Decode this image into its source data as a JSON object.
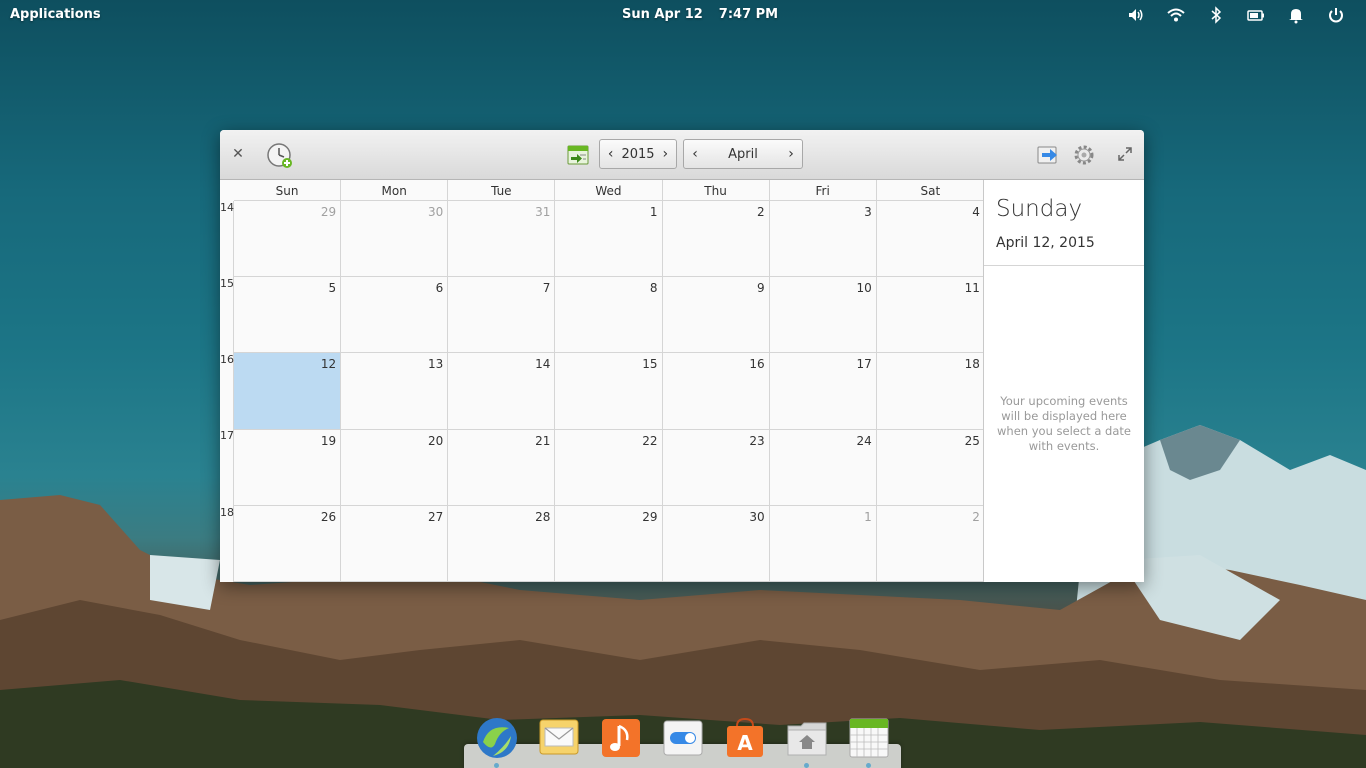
{
  "panel": {
    "applications": "Applications",
    "date": "Sun Apr 12",
    "time": "7:47 PM",
    "indicators": [
      "volume-icon",
      "wifi-icon",
      "bluetooth-icon",
      "battery-icon",
      "notifications-icon",
      "power-icon"
    ]
  },
  "window": {
    "year": "2015",
    "month": "April",
    "weekdays": [
      "Sun",
      "Mon",
      "Tue",
      "Wed",
      "Thu",
      "Fri",
      "Sat"
    ],
    "week_numbers": [
      "14",
      "15",
      "16",
      "17",
      "18"
    ],
    "weeks": [
      [
        {
          "d": "29",
          "o": true
        },
        {
          "d": "30",
          "o": true
        },
        {
          "d": "31",
          "o": true
        },
        {
          "d": "1"
        },
        {
          "d": "2"
        },
        {
          "d": "3"
        },
        {
          "d": "4"
        }
      ],
      [
        {
          "d": "5"
        },
        {
          "d": "6"
        },
        {
          "d": "7"
        },
        {
          "d": "8"
        },
        {
          "d": "9"
        },
        {
          "d": "10"
        },
        {
          "d": "11"
        }
      ],
      [
        {
          "d": "12",
          "s": true
        },
        {
          "d": "13"
        },
        {
          "d": "14"
        },
        {
          "d": "15"
        },
        {
          "d": "16"
        },
        {
          "d": "17"
        },
        {
          "d": "18"
        }
      ],
      [
        {
          "d": "19"
        },
        {
          "d": "20"
        },
        {
          "d": "21"
        },
        {
          "d": "22"
        },
        {
          "d": "23"
        },
        {
          "d": "24"
        },
        {
          "d": "25"
        }
      ],
      [
        {
          "d": "26"
        },
        {
          "d": "27"
        },
        {
          "d": "28"
        },
        {
          "d": "29"
        },
        {
          "d": "30"
        },
        {
          "d": "1",
          "o": true
        },
        {
          "d": "2",
          "o": true
        }
      ]
    ],
    "sidebar": {
      "day_name": "Sunday",
      "date": "April 12, 2015",
      "empty_message": "Your upcoming events will be displayed here when you select a date with events."
    }
  },
  "dock": {
    "apps": [
      "browser-icon",
      "mail-icon",
      "music-icon",
      "settings-icon",
      "appcenter-icon",
      "files-icon",
      "calendar-icon"
    ]
  },
  "colors": {
    "selected_day": "#bcdaf2",
    "accent": "#3689e6"
  }
}
